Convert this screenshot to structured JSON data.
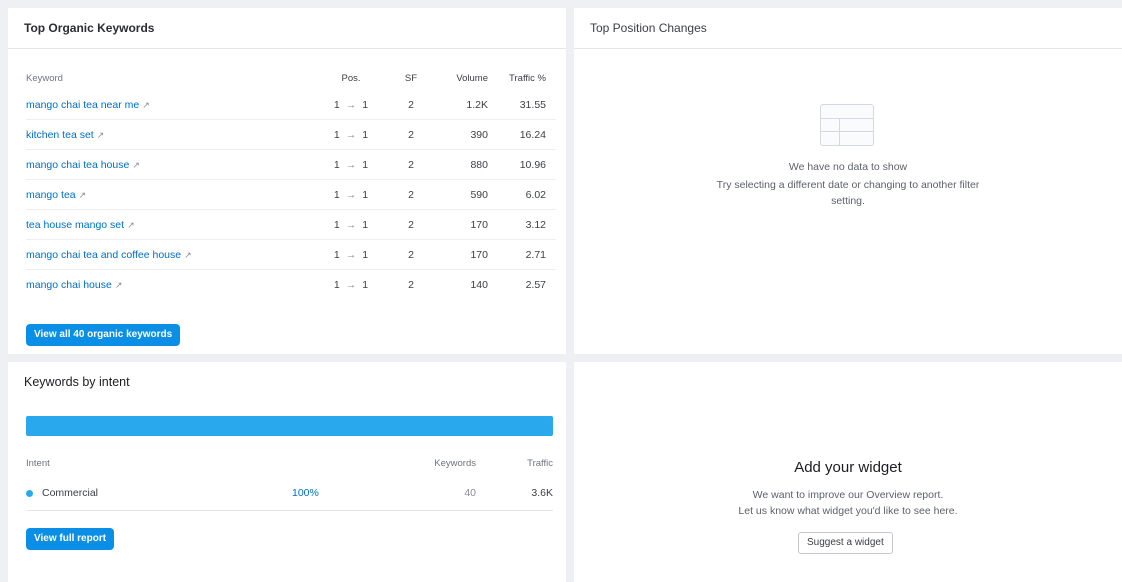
{
  "top_keywords": {
    "title": "Top Organic Keywords",
    "columns": {
      "keyword": "Keyword",
      "pos": "Pos.",
      "sf": "SF",
      "volume": "Volume",
      "traffic": "Traffic %"
    },
    "rows": [
      {
        "keyword": "mango chai tea near me",
        "pos_from": "1",
        "pos_to": "1",
        "sf": "2",
        "volume": "1.2K",
        "traffic": "31.55"
      },
      {
        "keyword": "kitchen tea set",
        "pos_from": "1",
        "pos_to": "1",
        "sf": "2",
        "volume": "390",
        "traffic": "16.24"
      },
      {
        "keyword": "mango chai tea house",
        "pos_from": "1",
        "pos_to": "1",
        "sf": "2",
        "volume": "880",
        "traffic": "10.96"
      },
      {
        "keyword": "mango tea",
        "pos_from": "1",
        "pos_to": "1",
        "sf": "2",
        "volume": "590",
        "traffic": "6.02"
      },
      {
        "keyword": "tea house mango set",
        "pos_from": "1",
        "pos_to": "1",
        "sf": "2",
        "volume": "170",
        "traffic": "3.12"
      },
      {
        "keyword": "mango chai tea and coffee house",
        "pos_from": "1",
        "pos_to": "1",
        "sf": "2",
        "volume": "170",
        "traffic": "2.71"
      },
      {
        "keyword": "mango chai house",
        "pos_from": "1",
        "pos_to": "1",
        "sf": "2",
        "volume": "140",
        "traffic": "2.57"
      }
    ],
    "ext_icon": "↗",
    "arrow": "→",
    "button": "View all 40 organic keywords"
  },
  "top_position_changes": {
    "title": "Top Position Changes",
    "empty_title": "We have no data to show",
    "empty_line1": "Try selecting a different date or changing to another filter",
    "empty_line2": "setting."
  },
  "intent": {
    "title": "Keywords by intent",
    "columns": {
      "intent": "Intent",
      "keywords": "Keywords",
      "traffic": "Traffic"
    },
    "rows": [
      {
        "name": "Commercial",
        "percent": "100%",
        "keywords": "40",
        "traffic": "3.6K"
      }
    ],
    "bar_color": "#29a8ee",
    "button": "View full report"
  },
  "widget": {
    "title": "Add your widget",
    "line1": "We want to improve our Overview report.",
    "line2": "Let us know what widget you'd like to see here.",
    "button": "Suggest a widget"
  }
}
